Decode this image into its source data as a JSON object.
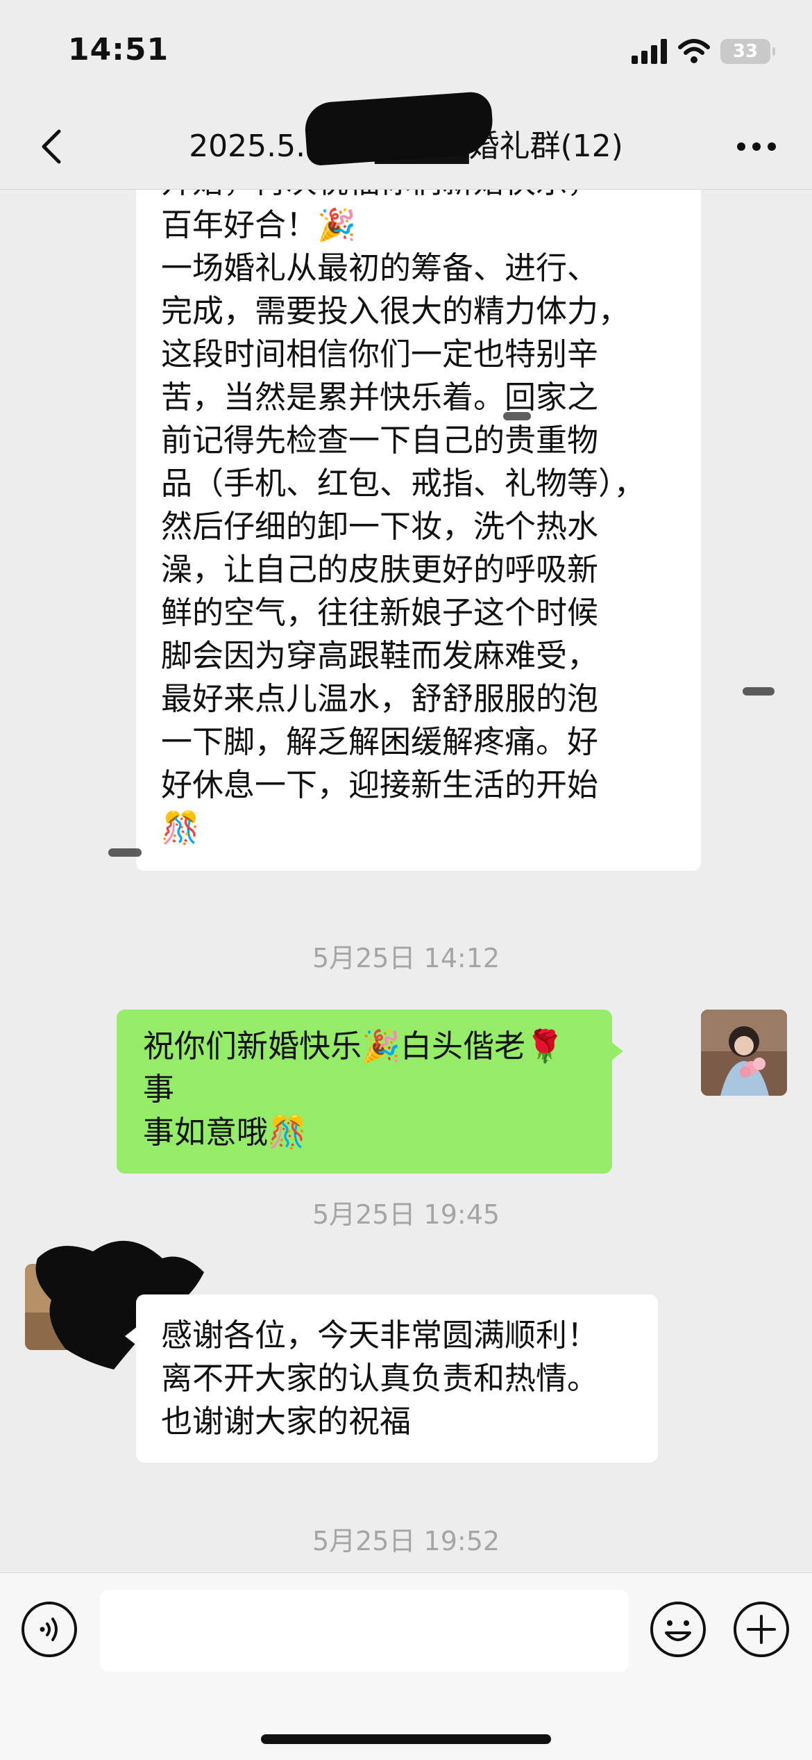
{
  "status": {
    "time": "14:51",
    "battery": "33"
  },
  "nav": {
    "title": "2025.5.25秦████婚礼群(12)"
  },
  "messages": {
    "msg1_lines": [
      "开始，再次祝福你们新婚快乐，",
      "百年好合！🎉",
      "一场婚礼从最初的筹备、进行、",
      "完成，需要投入很大的精力体力，",
      "这段时间相信你们一定也特别辛",
      "苦，当然是累并快乐着。回家之",
      "前记得先检查一下自己的贵重物",
      "品（手机、红包、戒指、礼物等），",
      "然后仔细的卸一下妆，洗个热水",
      "澡，让自己的皮肤更好的呼吸新",
      "鲜的空气，往往新娘子这个时候",
      "脚会因为穿高跟鞋而发麻难受，",
      "最好来点儿温水，舒舒服服的泡",
      "一下脚，解乏解困缓解疼痛。好",
      "好休息一下，迎接新生活的开始",
      "🎊"
    ],
    "timestamp1": "5月25日 14:12",
    "msg2_lines": [
      "祝你们新婚快乐🎉白头偕老🌹事",
      "事如意哦🎊"
    ],
    "timestamp2": "5月25日 19:45",
    "msg3_lines": [
      "感谢各位，今天非常圆满顺利！",
      "离不开大家的认真负责和热情。",
      "也谢谢大家的祝福"
    ],
    "timestamp3": "5月25日 19:52"
  },
  "input": {
    "placeholder": ""
  },
  "icons": {
    "back": "chevron-left-icon",
    "more": "more-horizontal-icon",
    "voice": "voice-icon",
    "emoji": "emoji-icon",
    "plus": "plus-icon"
  },
  "colors": {
    "background": "#ededed",
    "bubble_out": "#95ec69",
    "bubble_in": "#ffffff",
    "timestamp": "#a5a5a5"
  }
}
